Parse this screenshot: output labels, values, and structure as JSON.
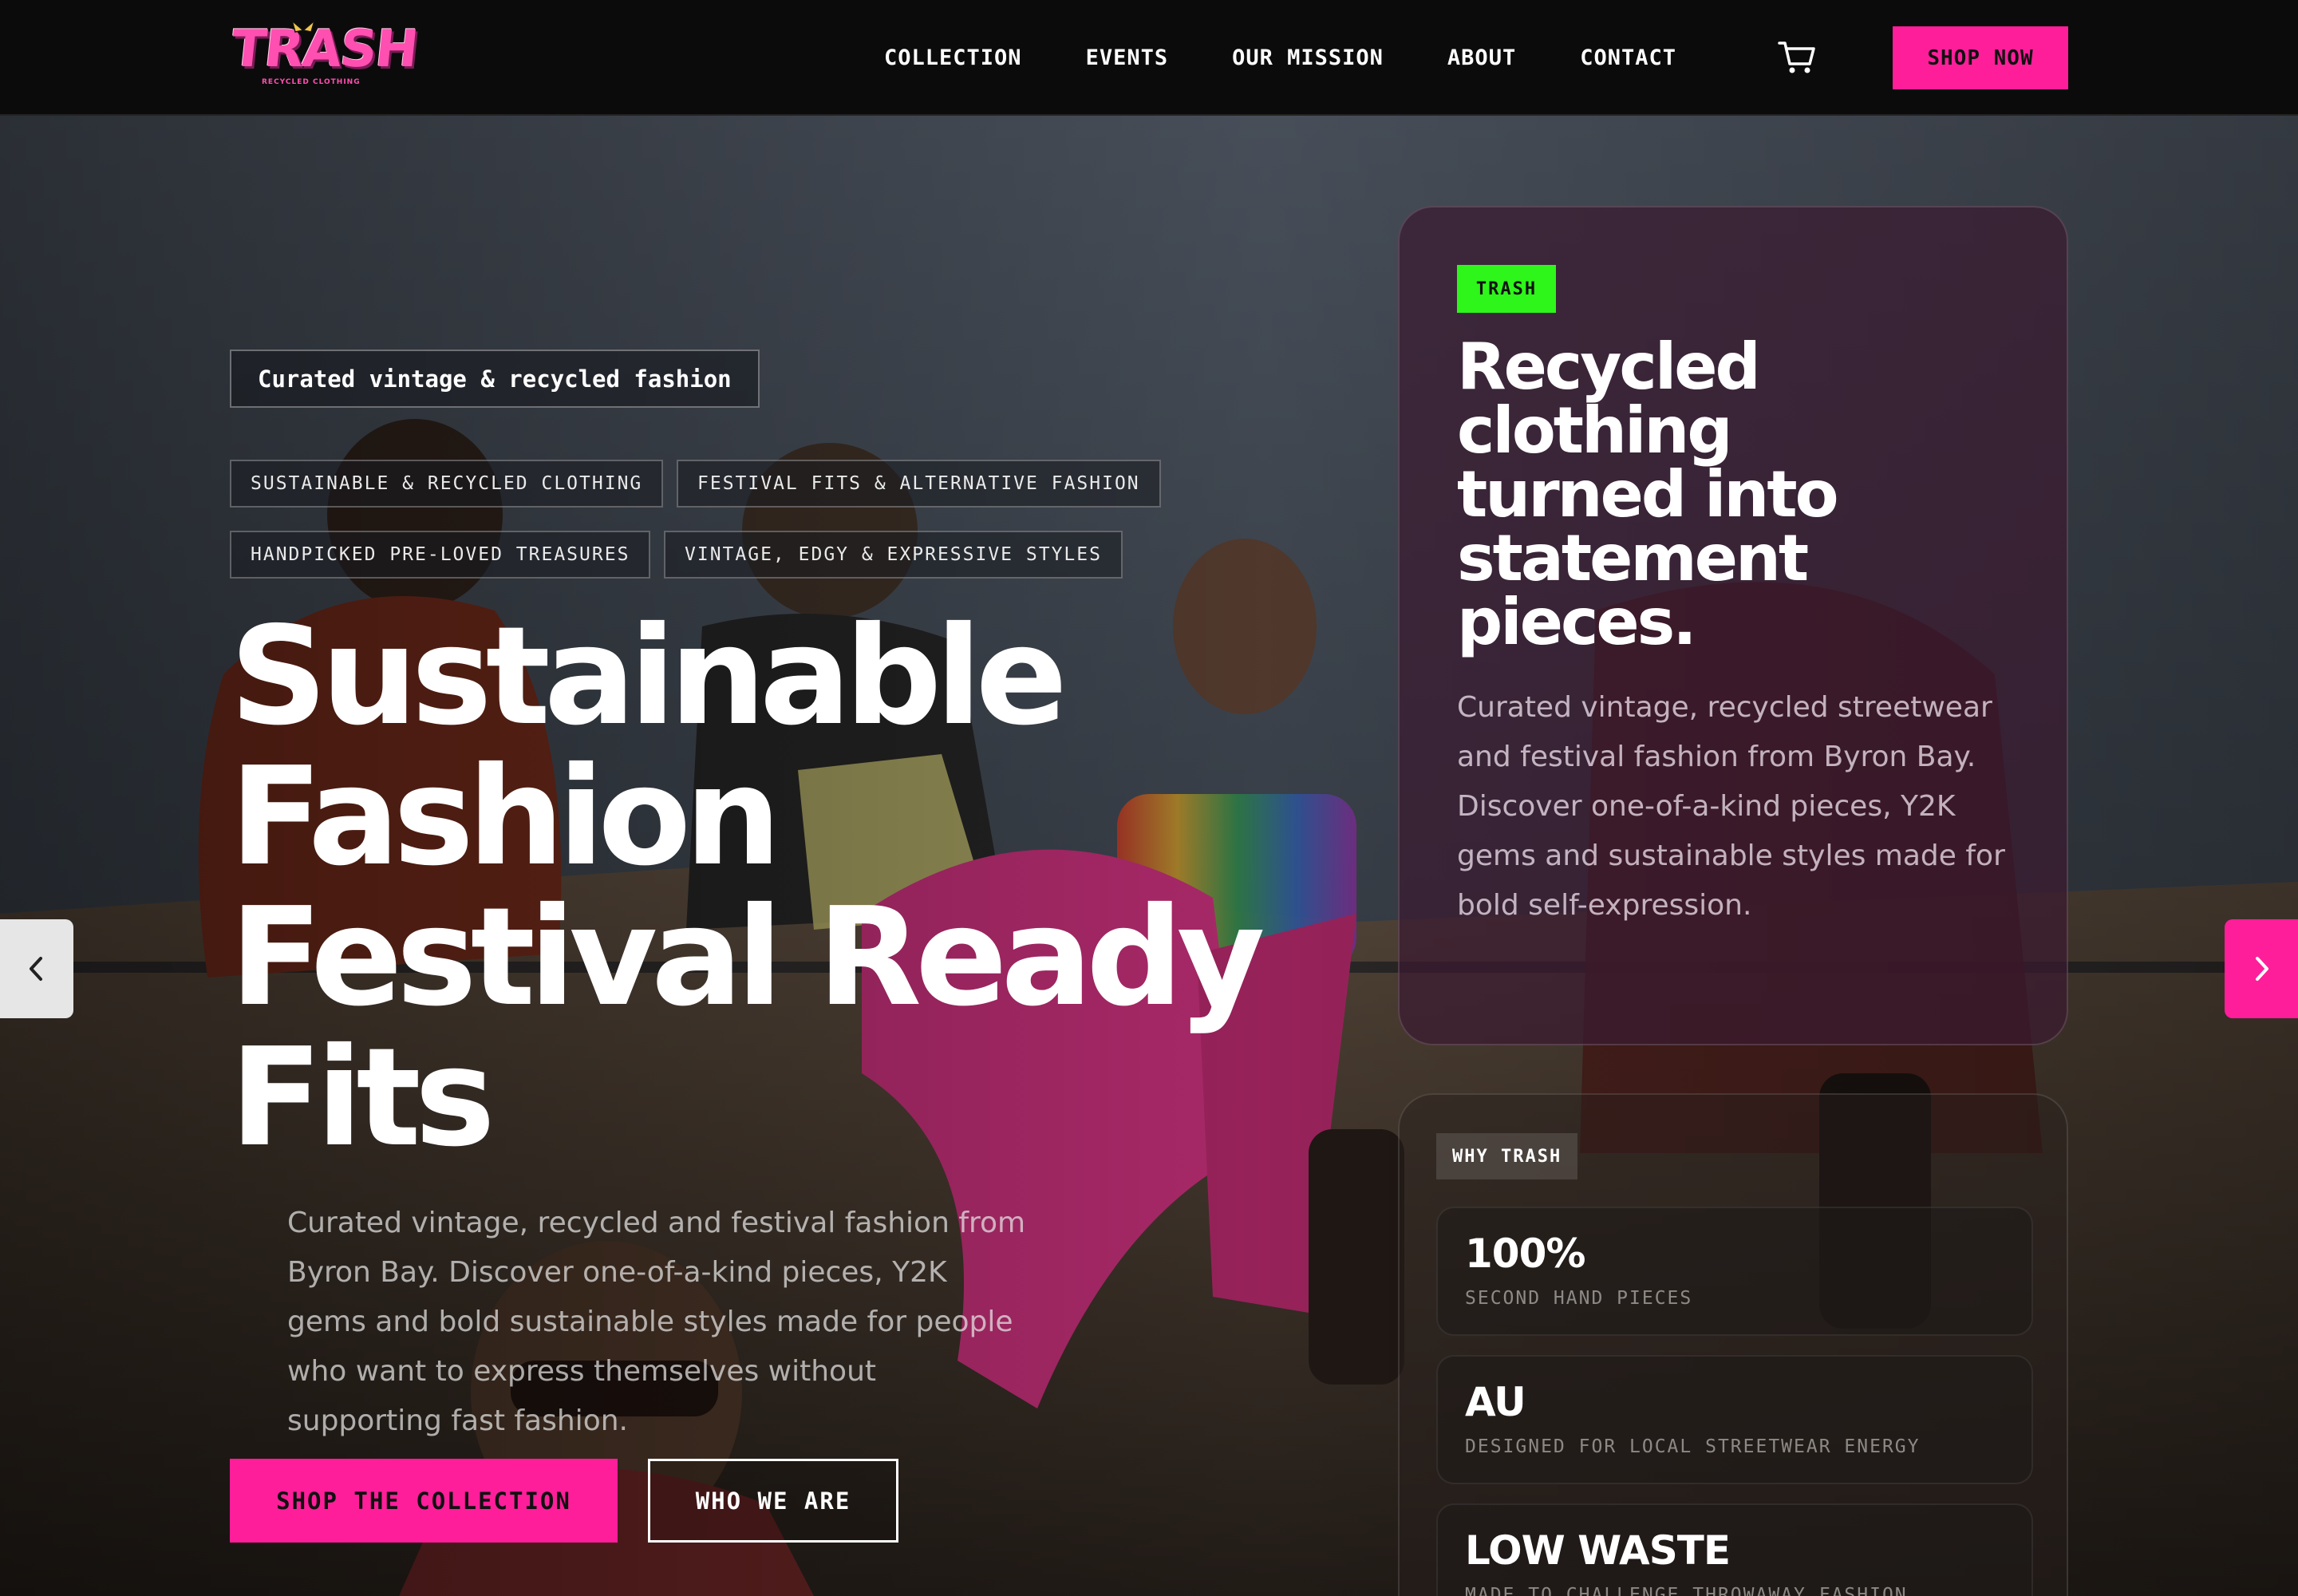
{
  "nav": {
    "logo_text": "TRASH",
    "logo_subtext": "RECYCLED CLOTHING",
    "links": [
      "COLLECTION",
      "EVENTS",
      "OUR MISSION",
      "ABOUT",
      "CONTACT"
    ],
    "cart_icon": "cart-icon",
    "shop_now_label": "SHOP NOW"
  },
  "hero": {
    "eyebrow": "Curated vintage & recycled fashion",
    "tags": [
      "SUSTAINABLE & RECYCLED CLOTHING",
      "FESTIVAL FITS & ALTERNATIVE FASHION",
      "HANDPICKED PRE-LOVED TREASURES",
      "VINTAGE, EDGY & EXPRESSIVE STYLES"
    ],
    "headline_lines": [
      "Sustainable",
      "Fashion",
      "Festival Ready",
      "Fits"
    ],
    "description": "Curated vintage, recycled and festival fashion from Byron Bay. Discover one-of-a-kind pieces, Y2K gems and bold sustainable styles made for people who want to express themselves without supporting fast fashion.",
    "primary_cta": "SHOP THE COLLECTION",
    "secondary_cta": "WHO WE ARE"
  },
  "slider": {
    "prev_icon": "chevron-left-icon",
    "next_icon": "chevron-right-icon"
  },
  "info_card": {
    "badge": "TRASH",
    "title_lines": [
      "Recycled",
      "clothing",
      "turned into",
      "statement",
      "pieces."
    ],
    "description": "Curated vintage, recycled streetwear and festival fashion from Byron Bay. Discover one-of-a-kind pieces, Y2K gems and sustainable styles made for bold self-expression."
  },
  "why": {
    "label": "WHY TRASH",
    "stats": [
      {
        "value": "100%",
        "label": "SECOND HAND PIECES"
      },
      {
        "value": "AU",
        "label": "DESIGNED FOR LOCAL STREETWEAR ENERGY"
      },
      {
        "value": "LOW WASTE",
        "label": "MADE TO CHALLENGE THROWAWAY FASHION"
      }
    ]
  },
  "colors": {
    "accent_pink": "#ff1e9a",
    "badge_green": "#2ef51a",
    "nav_bg": "#0b0b0b"
  }
}
